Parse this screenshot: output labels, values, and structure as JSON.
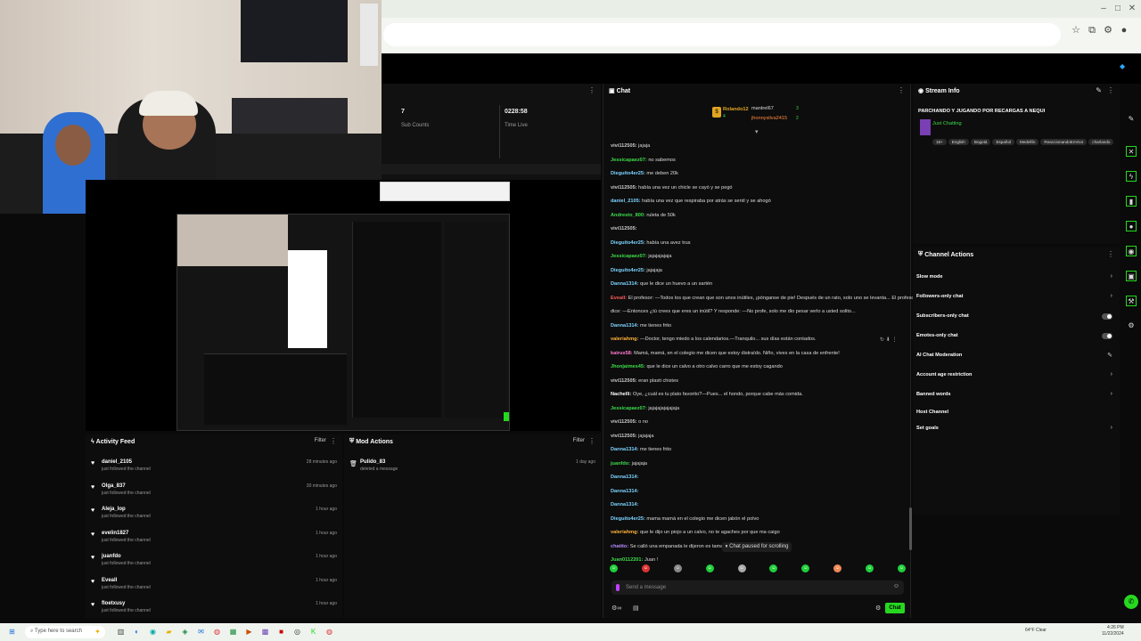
{
  "browser": {
    "win_min": "–",
    "win_max": "□",
    "win_close": "✕"
  },
  "stats": [
    {
      "value": "7",
      "label": "Sub Counts"
    },
    {
      "value": "0228:58",
      "label": "Time Live"
    }
  ],
  "chat": {
    "title": "Chat",
    "top_users": [
      {
        "name": "Rolando12",
        "count": "4"
      },
      {
        "name": "mantrel67",
        "count": "3"
      },
      {
        "name": "jhonnysilva2415",
        "count": "2"
      }
    ],
    "lines": [
      {
        "user": "vivi112505:",
        "color": "#c9c9c9",
        "text": "jajaja"
      },
      {
        "user": "Jessicapaez07:",
        "color": "#3ddc4b",
        "text": "no sabemos"
      },
      {
        "user": "Dieguito4er25:",
        "color": "#7cd3ff",
        "text": "me deben 20k"
      },
      {
        "user": "vivi112505:",
        "color": "#c9c9c9",
        "text": "había una vez un chicle se cayó y se pegó"
      },
      {
        "user": "daniel_2105:",
        "color": "#7cd3ff",
        "text": "había una vez que respiraba por atrás se sentí y se ahogó"
      },
      {
        "user": "Andresto_800:",
        "color": "#3ddc4b",
        "text": "ruleta de 50k"
      },
      {
        "user": "vivi112505:",
        "color": "#c9c9c9",
        "text": ""
      },
      {
        "user": "Dieguito4er25:",
        "color": "#7cd3ff",
        "text": "había una avez trus"
      },
      {
        "user": "Jessicapaez07:",
        "color": "#3ddc4b",
        "text": "jajajajajaja"
      },
      {
        "user": "Dieguito4er25:",
        "color": "#7cd3ff",
        "text": "jajajaja"
      },
      {
        "user": "Danna1314:",
        "color": "#7cd3ff",
        "text": "que le dice un huevo a un sartén"
      },
      {
        "user": "Eveall:",
        "color": "#ff5a5a",
        "text": "El profesor: —Todos los que crean que son unos inútiles, ¡pónganse de pie! Después de un rato, solo uno se levanta... El profesor"
      },
      {
        "user": "",
        "color": "#ddd",
        "text": "dice: —Entonces ¿tú crees que eres un inútil? Y responde: —No profe, solo me dio pesar verlo a usted solito..."
      },
      {
        "user": "Danna1314:",
        "color": "#7cd3ff",
        "text": "me tienes frito"
      },
      {
        "user": "valeriahmg:",
        "color": "#ffb13b",
        "text": "—Doctor, tengo miedo a los calendarios.—Tranquilo... sus días están contados."
      },
      {
        "user": "kairus58:",
        "color": "#ff7ad1",
        "text": "Mamá, mamá, en el colegio me dicen que estoy distraído. Niño, vives en la casa de enfrente!"
      },
      {
        "user": "Jhonjaimes45:",
        "color": "#3ddc4b",
        "text": "que le dice un calvo a otro calvo carro que me estoy cagando"
      },
      {
        "user": "vivi112505:",
        "color": "#c9c9c9",
        "text": "eran plasti chistes"
      },
      {
        "user": "Nachelli:",
        "color": "#ffffff",
        "text": "Oye, ¿cuál es tu plato favorito?—Pues... el hondo, porque cabe más comida."
      },
      {
        "user": "Jessicapaez07:",
        "color": "#3ddc4b",
        "text": "jajajajajajajaja"
      },
      {
        "user": "vivi112505:",
        "color": "#c9c9c9",
        "text": "o no"
      },
      {
        "user": "vivi112505:",
        "color": "#c9c9c9",
        "text": "jajajaja"
      },
      {
        "user": "Danna1314:",
        "color": "#7cd3ff",
        "text": "me tienes frito"
      },
      {
        "user": "juanfdo:",
        "color": "#3ddc4b",
        "text": "jajajaja"
      },
      {
        "user": "Danna1314:",
        "color": "#7cd3ff",
        "text": ""
      },
      {
        "user": "Danna1314:",
        "color": "#7cd3ff",
        "text": ""
      },
      {
        "user": "Danna1314:",
        "color": "#7cd3ff",
        "text": ""
      },
      {
        "user": "Dieguito4er25:",
        "color": "#7cd3ff",
        "text": "mama mamá en el colegio me dicen jabón el polvo"
      },
      {
        "user": "valeriahmg:",
        "color": "#ffb13b",
        "text": "que le dijo un piojo a un calvo, no te agaches por que ma caigo"
      },
      {
        "user": "chatito:",
        "color": "#b38bff",
        "text": "Se calló una empanada le dijeron es tamal y dij..."
      },
      {
        "user": "Juan0112201:",
        "color": "#3ddc4b",
        "text": "Juan !"
      }
    ],
    "paused": "Chat paused for scrolling",
    "placeholder": "Send a message",
    "send": "Chat"
  },
  "stream_info": {
    "title": "Stream Info",
    "stream_title": "PARCHANDO Y JUGANDO POR RECARGAS A NEQUI",
    "category": "Just Chatting",
    "tags": [
      "18+",
      "English",
      "Bogotá",
      "Español",
      "Medellín",
      "ReaccionandoEnVivo",
      "charlando"
    ]
  },
  "channel_actions": {
    "title": "Channel Actions",
    "items": [
      {
        "label": "Slow mode",
        "kind": "arrow"
      },
      {
        "label": "Followers-only chat",
        "kind": "arrow"
      },
      {
        "label": "Subscribers-only chat",
        "kind": "toggle"
      },
      {
        "label": "Emotes-only chat",
        "kind": "toggle"
      },
      {
        "label": "AI Chat Moderation",
        "kind": "edit"
      },
      {
        "label": "Account age restriction",
        "kind": "arrow"
      },
      {
        "label": "Banned words",
        "kind": "arrow"
      },
      {
        "label": "Host Channel",
        "kind": "none"
      },
      {
        "label": "Set goals",
        "kind": "arrow"
      }
    ]
  },
  "activity": {
    "title": "Activity Feed",
    "filter": "Filter",
    "items": [
      {
        "name": "daniel_2105",
        "sub": "just followed the channel",
        "time": "28 minutes ago"
      },
      {
        "name": "Olga_837",
        "sub": "just followed the channel",
        "time": "30 minutes ago"
      },
      {
        "name": "Aleja_lop",
        "sub": "just followed the channel",
        "time": "1 hour ago"
      },
      {
        "name": "evelin1827",
        "sub": "just followed the channel",
        "time": "1 hour ago"
      },
      {
        "name": "juanfdo",
        "sub": "just followed the channel",
        "time": "1 hour ago"
      },
      {
        "name": "Eveall",
        "sub": "just followed the channel",
        "time": "1 hour ago"
      },
      {
        "name": "floetxusy",
        "sub": "just followed the channel",
        "time": "1 hour ago"
      }
    ]
  },
  "mod": {
    "title": "Mod Actions",
    "filter": "Filter",
    "items": [
      {
        "name": "Pulido_83",
        "sub": "deleted a message",
        "time": "1 day ago"
      }
    ]
  },
  "taskbar": {
    "search": "Type here to search",
    "weather": "64°F Clear",
    "time": "4:26 PM",
    "date": "11/22/2024"
  }
}
